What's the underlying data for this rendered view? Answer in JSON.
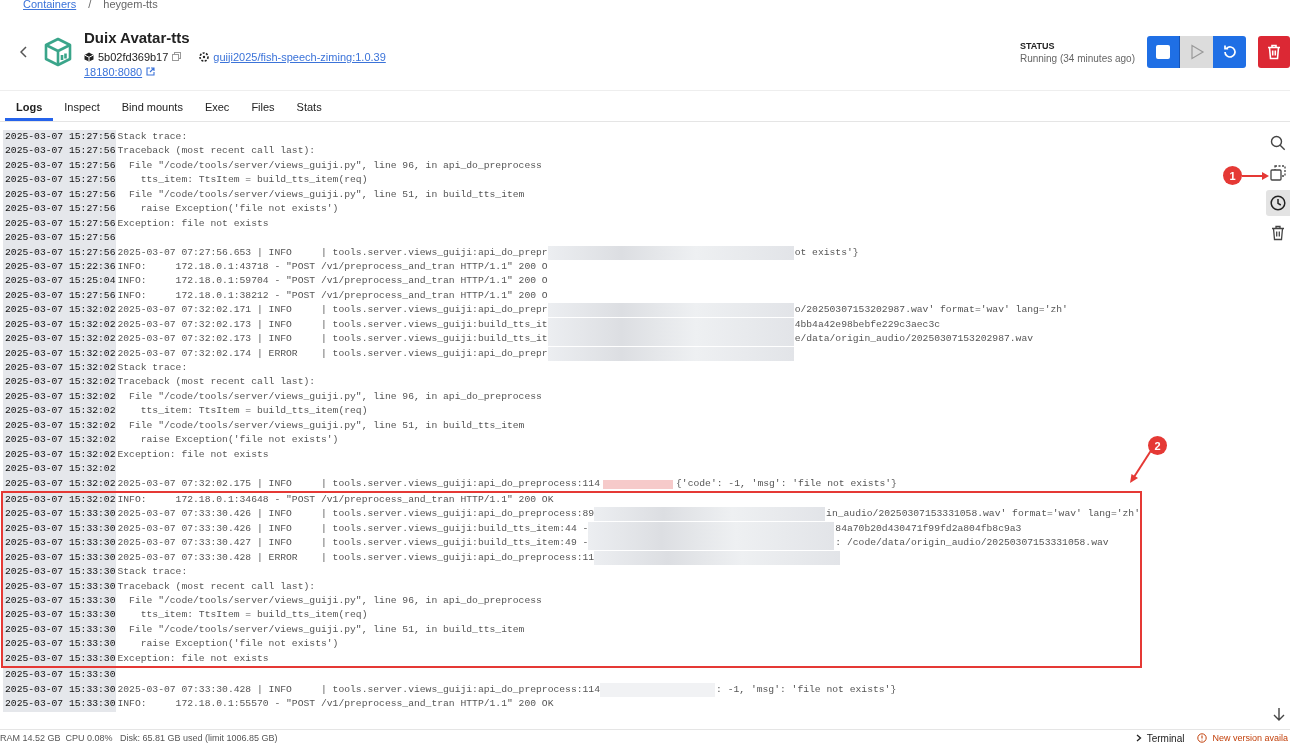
{
  "breadcrumb": [
    {
      "label": "Containers",
      "kind": "link"
    },
    {
      "label": "/",
      "kind": "separator"
    },
    {
      "label": "heygem-tts",
      "kind": "current"
    }
  ],
  "container": {
    "name": "Duix Avatar-tts",
    "id": "5b02fd369b17",
    "image": "guiji2025/fish-speech-ziming:1.0.39",
    "port": "18180:8080"
  },
  "status": {
    "label": "STATUS",
    "value": "Running (34 minutes ago)"
  },
  "actions": [
    {
      "kind": "stop",
      "disabled": false
    },
    {
      "kind": "start",
      "disabled": true
    },
    {
      "kind": "restart",
      "disabled": false
    },
    {
      "kind": "delete",
      "disabled": false
    }
  ],
  "tabs": [
    {
      "label": "Logs",
      "selected": true
    },
    {
      "label": "Inspect",
      "selected": false
    },
    {
      "label": "Bind mounts",
      "selected": false
    },
    {
      "label": "Exec",
      "selected": false
    },
    {
      "label": "Files",
      "selected": false
    },
    {
      "label": "Stats",
      "selected": false
    }
  ],
  "log_tools": [
    {
      "kind": "search",
      "selected": false
    },
    {
      "kind": "copy",
      "selected": false
    },
    {
      "kind": "timestamps",
      "selected": true
    },
    {
      "kind": "clear",
      "selected": false
    }
  ],
  "log_lines": [
    {
      "time": "2025-03-07 15:27:56",
      "text": "Stack trace:",
      "boxed": false
    },
    {
      "time": "2025-03-07 15:27:56",
      "text": "Traceback (most recent call last):",
      "boxed": false
    },
    {
      "time": "2025-03-07 15:27:56",
      "text": "  File \"/code/tools/server/views_guiji.py\", line 96, in api_do_preprocess",
      "boxed": false
    },
    {
      "time": "2025-03-07 15:27:56",
      "text": "    tts_item: TtsItem = build_tts_item(req)",
      "boxed": false
    },
    {
      "time": "2025-03-07 15:27:56",
      "text": "  File \"/code/tools/server/views_guiji.py\", line 51, in build_tts_item",
      "boxed": false
    },
    {
      "time": "2025-03-07 15:27:56",
      "text": "    raise Exception('file not exists')",
      "boxed": false
    },
    {
      "time": "2025-03-07 15:27:56",
      "text": "Exception: file not exists",
      "boxed": false
    },
    {
      "time": "2025-03-07 15:27:56",
      "boxed": false
    },
    {
      "time": "2025-03-07 15:27:56",
      "text": "2025-03-07 07:27:56.653 | INFO     | tools.server.views_guiji:api_do_prepr",
      "kind": "redacted",
      "tail": "ot exists'}",
      "boxed": false
    },
    {
      "time": "2025-03-07 15:22:36",
      "text": "INFO:     172.18.0.1:43718 - \"POST /v1/preprocess_and_tran HTTP/1.1\" 200 O",
      "boxed": false
    },
    {
      "time": "2025-03-07 15:25:04",
      "text": "INFO:     172.18.0.1:59704 - \"POST /v1/preprocess_and_tran HTTP/1.1\" 200 O",
      "boxed": false
    },
    {
      "time": "2025-03-07 15:27:56",
      "text": "INFO:     172.18.0.1:38212 - \"POST /v1/preprocess_and_tran HTTP/1.1\" 200 O",
      "boxed": false
    },
    {
      "time": "2025-03-07 15:32:02",
      "text": "2025-03-07 07:32:02.171 | INFO     | tools.server.views_guiji:api_do_prepr",
      "kind": "redacted",
      "tail": "o/20250307153202987.wav' format='wav' lang='zh'",
      "boxed": false
    },
    {
      "time": "2025-03-07 15:32:02",
      "text": "2025-03-07 07:32:02.173 | INFO     | tools.server.views_guiji:build_tts_it",
      "kind": "redacted",
      "tail": "4bb4a42e98bebfe229c3aec3c",
      "boxed": false
    },
    {
      "time": "2025-03-07 15:32:02",
      "text": "2025-03-07 07:32:02.173 | INFO     | tools.server.views_guiji:build_tts_it",
      "kind": "redacted",
      "tail": "e/data/origin_audio/20250307153202987.wav",
      "boxed": false
    },
    {
      "time": "2025-03-07 15:32:02",
      "text": "2025-03-07 07:32:02.174 | ERROR    | tools.server.views_guiji:api_do_prepr",
      "kind": "redacted",
      "boxed": false
    },
    {
      "time": "2025-03-07 15:32:02",
      "text": "Stack trace:",
      "boxed": false
    },
    {
      "time": "2025-03-07 15:32:02",
      "text": "Traceback (most recent call last):",
      "boxed": false
    },
    {
      "time": "2025-03-07 15:32:02",
      "text": "  File \"/code/tools/server/views_guiji.py\", line 96, in api_do_preprocess",
      "boxed": false
    },
    {
      "time": "2025-03-07 15:32:02",
      "text": "    tts_item: TtsItem = build_tts_item(req)",
      "boxed": false
    },
    {
      "time": "2025-03-07 15:32:02",
      "text": "  File \"/code/tools/server/views_guiji.py\", line 51, in build_tts_item",
      "boxed": false
    },
    {
      "time": "2025-03-07 15:32:02",
      "text": "    raise Exception('file not exists')",
      "boxed": false
    },
    {
      "time": "2025-03-07 15:32:02",
      "text": "Exception: file not exists",
      "boxed": false
    },
    {
      "time": "2025-03-07 15:32:02",
      "boxed": false
    },
    {
      "time": "2025-03-07 15:32:02",
      "text": "2025-03-07 07:32:02.175 | INFO     | tools.server.views_guiji:api_do_preprocess:114",
      "kind": "highlighted",
      "tail": "{'code': -1, 'msg': 'file not exists'}",
      "boxed": false
    },
    {
      "time": "2025-03-07 15:32:02",
      "text": "INFO:     172.18.0.1:34648 - \"POST /v1/preprocess_and_tran HTTP/1.1\" 200 OK",
      "boxed": true
    },
    {
      "time": "2025-03-07 15:33:30",
      "text": "2025-03-07 07:33:30.426 | INFO     | tools.server.views_guiji:api_do_preprocess:89",
      "kind": "redacted",
      "tail": "in_audio/20250307153331058.wav' format='wav' lang='zh'",
      "boxed": true
    },
    {
      "time": "2025-03-07 15:33:30",
      "text": "2025-03-07 07:33:30.426 | INFO     | tools.server.views_guiji:build_tts_item:44 -",
      "kind": "redacted",
      "tail": "84a70b20d430471f99fd2a804fb8c9a3",
      "boxed": true
    },
    {
      "time": "2025-03-07 15:33:30",
      "text": "2025-03-07 07:33:30.427 | INFO     | tools.server.views_guiji:build_tts_item:49 -",
      "kind": "redacted",
      "tail": ": /code/data/origin_audio/20250307153331058.wav",
      "boxed": true
    },
    {
      "time": "2025-03-07 15:33:30",
      "text": "2025-03-07 07:33:30.428 | ERROR    | tools.server.views_guiji:api_do_preprocess:11",
      "kind": "redacted",
      "boxed": true
    },
    {
      "time": "2025-03-07 15:33:30",
      "text": "Stack trace:",
      "boxed": true
    },
    {
      "time": "2025-03-07 15:33:30",
      "text": "Traceback (most recent call last):",
      "boxed": true
    },
    {
      "time": "2025-03-07 15:33:30",
      "text": "  File \"/code/tools/server/views_guiji.py\", line 96, in api_do_preprocess",
      "boxed": true
    },
    {
      "time": "2025-03-07 15:33:30",
      "text": "    tts_item: TtsItem = build_tts_item(req)",
      "boxed": true
    },
    {
      "time": "2025-03-07 15:33:30",
      "text": "  File \"/code/tools/server/views_guiji.py\", line 51, in build_tts_item",
      "boxed": true
    },
    {
      "time": "2025-03-07 15:33:30",
      "text": "    raise Exception('file not exists')",
      "boxed": true
    },
    {
      "time": "2025-03-07 15:33:30",
      "text": "Exception: file not exists",
      "boxed": true
    },
    {
      "time": "2025-03-07 15:33:30",
      "boxed": false
    },
    {
      "time": "2025-03-07 15:33:30",
      "text": "2025-03-07 07:33:30.428 | INFO     | tools.server.views_guiji:api_do_preprocess:114",
      "kind": "blurred",
      "tail": ": -1, 'msg': 'file not exists'}",
      "boxed": false
    },
    {
      "time": "2025-03-07 15:33:30",
      "text": "INFO:     172.18.0.1:55570 - \"POST /v1/preprocess_and_tran HTTP/1.1\" 200 OK",
      "boxed": false
    }
  ],
  "annotations": [
    {
      "label": "1",
      "kind": "toolbar"
    },
    {
      "label": "2",
      "kind": "box"
    }
  ],
  "status_bar": {
    "stats": "RAM 14.52 GB  CPU 0.08%   Disk: 65.81 GB used (limit 1006.85 GB)",
    "terminal": "Terminal",
    "update": "New version availa"
  }
}
